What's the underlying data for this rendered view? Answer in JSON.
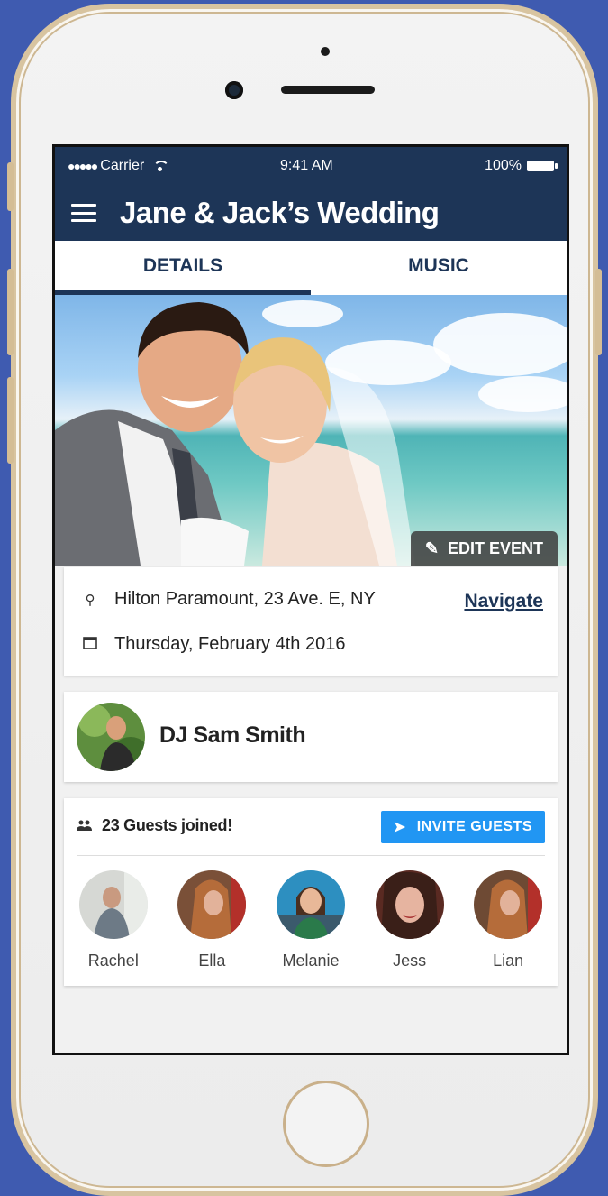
{
  "status_bar": {
    "signal": "●●●●●",
    "carrier": "Carrier",
    "time": "9:41 AM",
    "battery": "100%"
  },
  "app_bar": {
    "title": "Jane & Jack’s Wedding"
  },
  "tabs": [
    {
      "label": "DETAILS",
      "active": true
    },
    {
      "label": "MUSIC",
      "active": false
    }
  ],
  "hero": {
    "edit_label": "EDIT EVENT"
  },
  "location": {
    "address": "Hilton Paramount, 23 Ave. E, NY",
    "navigate_label": "Navigate",
    "date": "Thursday, February 4th 2016"
  },
  "dj": {
    "name": "DJ Sam Smith"
  },
  "guests": {
    "count_label": "23 Guests joined!",
    "invite_label": "INVITE GUESTS",
    "list": [
      {
        "name": "Rachel"
      },
      {
        "name": "Ella"
      },
      {
        "name": "Melanie"
      },
      {
        "name": "Jess"
      },
      {
        "name": "Lian"
      }
    ]
  },
  "colors": {
    "primary": "#1d3557",
    "accent": "#2196f3",
    "background": "#3f5bb0"
  }
}
